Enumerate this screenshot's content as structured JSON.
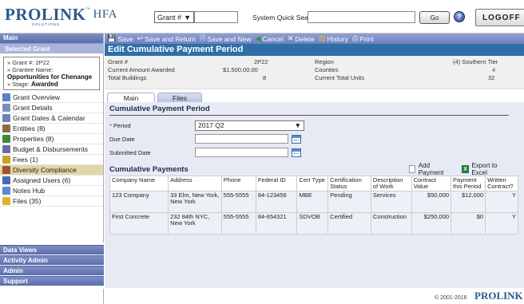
{
  "header": {
    "logo_main": "PRO",
    "logo_link": "LINK",
    "logo_tm": "™",
    "logo_solutions": "SOLUTIONS",
    "logo_suffix": "HFA",
    "grant_select": "Grant #",
    "quick_search_label": "System Quick Search:",
    "go_label": "Go",
    "help_label": "?",
    "logoff_label": "LOGOFF"
  },
  "sidebar": {
    "main_label": "Main",
    "selected_grant_label": "Selected Grant",
    "grant_info": {
      "grant_no": "» Grant #:  2P22",
      "grantee_label": "» Grantee Name:",
      "grantee_name": "Opportunities for Chenange",
      "stage_prefix": "» Stage: ",
      "stage_value": "Awarded"
    },
    "items": [
      {
        "label": "Grant Overview",
        "color": "#5b7fc8"
      },
      {
        "label": "Grant Details",
        "color": "#7a8fb8"
      },
      {
        "label": "Grant Dates & Calendar",
        "color": "#6b83b5"
      },
      {
        "label": "Entities (8)",
        "color": "#8c6b3e"
      },
      {
        "label": "Properties (8)",
        "color": "#3a8a3a"
      },
      {
        "label": "Budget & Disbursements",
        "color": "#6a6aa8"
      },
      {
        "label": "Fees (1)",
        "color": "#c9a227"
      },
      {
        "label": "Diversity Compliance",
        "color": "#a0522d"
      },
      {
        "label": "Assigned Users (6)",
        "color": "#4a6ab8"
      },
      {
        "label": "Notes Hub",
        "color": "#5a8ad0"
      },
      {
        "label": "Files (35)",
        "color": "#e0b030"
      }
    ],
    "bottom": [
      "Data Views",
      "Activity Admin",
      "Admin",
      "Support"
    ]
  },
  "toolbar": {
    "save": "Save",
    "save_return": "Save and Return",
    "save_new": "Save and New",
    "cancel": "Cancel",
    "delete": "Delete",
    "history": "History",
    "print": "Print"
  },
  "page_title": "Edit Cumulative Payment Period",
  "info": {
    "grant_label": "Grant #",
    "grant_value": "2P22",
    "region_label": "Region",
    "region_value": "(4) Southern Tier",
    "amount_label": "Current Amount Awarded",
    "amount_value": "$1,500,00.00",
    "counties_label": "Counties",
    "counties_value": "4",
    "buildings_label": "Total Buildings",
    "buildings_value": "8",
    "units_label": "Current Total Units",
    "units_value": "32"
  },
  "tabs": {
    "main": "Main",
    "files": "Files"
  },
  "form": {
    "section_title": "Cumulative Payment Period",
    "period_label": "Period",
    "period_value": "2017 Q2",
    "due_date_label": "Due Date",
    "submitted_date_label": "Submitted Date"
  },
  "payments": {
    "title": "Cumulative Payments",
    "add_label": "Add Payment",
    "export_label": "Export to Excel",
    "columns": [
      "Company Name",
      "Address",
      "Phone",
      "Federal ID",
      "Cert Type",
      "Certification Status",
      "Description of Work",
      "Contract Value",
      "Payment this Period",
      "Written Contract?"
    ],
    "rows": [
      [
        "123 Company",
        "33 Elm, New York, New York",
        "555-5555",
        "84-123456",
        "MBE",
        "Pending",
        "Services",
        "$50,000",
        "$12,000",
        "Y"
      ],
      [
        "First Concrete",
        "232 84th NYC, New York",
        "555-5555",
        "84-654321",
        "SDVOB",
        "Certified",
        "Construction",
        "$250,000",
        "$0",
        "Y"
      ]
    ]
  },
  "footer": {
    "copyright": "© 2001-2016",
    "logo": "PROLINK"
  }
}
